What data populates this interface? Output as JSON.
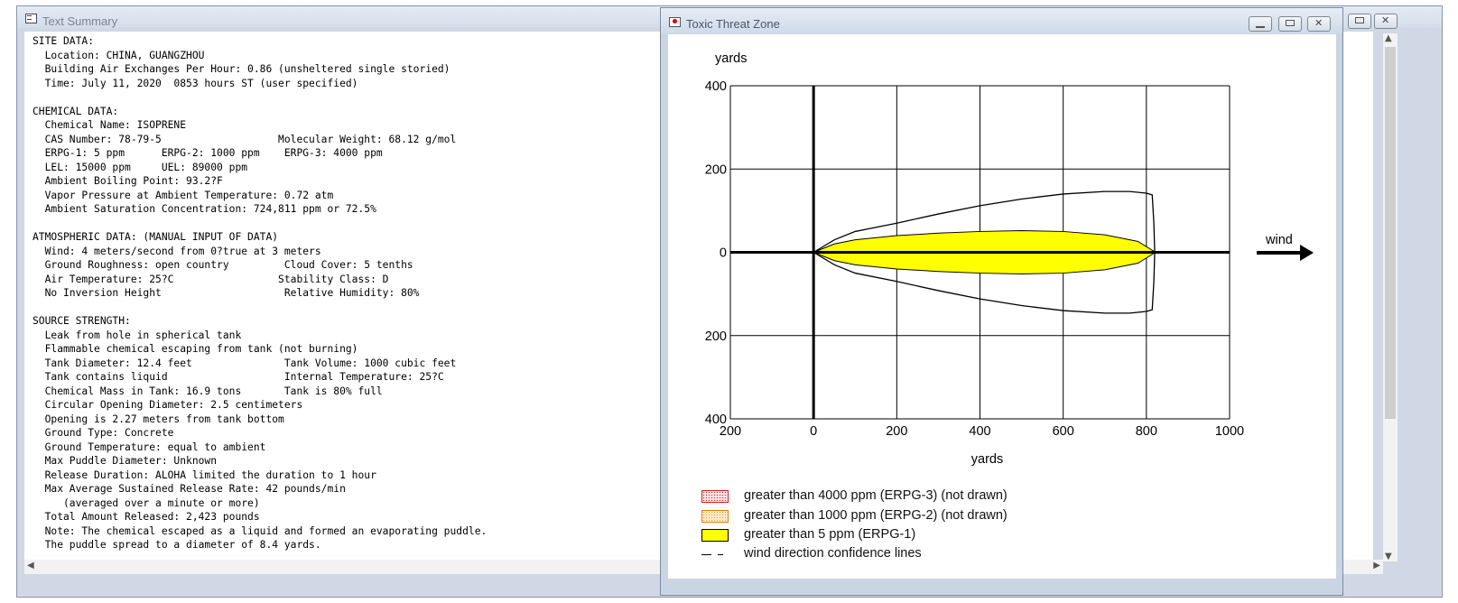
{
  "summary_window": {
    "title": "Text Summary",
    "lines": [
      "SITE DATA:",
      "  Location: CHINA, GUANGZHOU",
      "  Building Air Exchanges Per Hour: 0.86 (unsheltered single storied)",
      "  Time: July 11, 2020  0853 hours ST (user specified)",
      "",
      "CHEMICAL DATA:",
      "  Chemical Name: ISOPRENE",
      "  CAS Number: 78-79-5                   Molecular Weight: 68.12 g/mol",
      "  ERPG-1: 5 ppm      ERPG-2: 1000 ppm    ERPG-3: 4000 ppm",
      "  LEL: 15000 ppm     UEL: 89000 ppm",
      "  Ambient Boiling Point: 93.2?F",
      "  Vapor Pressure at Ambient Temperature: 0.72 atm",
      "  Ambient Saturation Concentration: 724,811 ppm or 72.5%",
      "",
      "ATMOSPHERIC DATA: (MANUAL INPUT OF DATA)",
      "  Wind: 4 meters/second from 0?true at 3 meters",
      "  Ground Roughness: open country         Cloud Cover: 5 tenths",
      "  Air Temperature: 25?C                 Stability Class: D",
      "  No Inversion Height                    Relative Humidity: 80%",
      "",
      "SOURCE STRENGTH:",
      "  Leak from hole in spherical tank",
      "  Flammable chemical escaping from tank (not burning)",
      "  Tank Diameter: 12.4 feet               Tank Volume: 1000 cubic feet",
      "  Tank contains liquid                   Internal Temperature: 25?C",
      "  Chemical Mass in Tank: 16.9 tons       Tank is 80% full",
      "  Circular Opening Diameter: 2.5 centimeters",
      "  Opening is 2.27 meters from tank bottom",
      "  Ground Type: Concrete",
      "  Ground Temperature: equal to ambient",
      "  Max Puddle Diameter: Unknown",
      "  Release Duration: ALOHA limited the duration to 1 hour",
      "  Max Average Sustained Release Rate: 42 pounds/min",
      "     (averaged over a minute or more)",
      "  Total Amount Released: 2,423 pounds",
      "  Note: The chemical escaped as a liquid and formed an evaporating puddle.",
      "  The puddle spread to a diameter of 8.4 yards."
    ]
  },
  "threat_window": {
    "title": "Toxic Threat Zone",
    "legend": [
      {
        "id": "erpg3",
        "label": "greater than 4000 ppm (ERPG-3) (not drawn)",
        "color": "#d02020"
      },
      {
        "id": "erpg2",
        "label": "greater than 1000 ppm (ERPG-2) (not drawn)",
        "color": "#e8a040"
      },
      {
        "id": "erpg1",
        "label": "greater than 5 ppm (ERPG-1)",
        "color": "#ffff00"
      },
      {
        "id": "conf",
        "label": "wind direction confidence lines",
        "color": "#000000"
      }
    ]
  },
  "chart_data": {
    "type": "area",
    "xlabel": "yards",
    "ylabel": "yards",
    "xlim": [
      -200,
      1000
    ],
    "ylim": [
      -400,
      400
    ],
    "x_tick_values": [
      -200,
      0,
      200,
      400,
      600,
      800,
      1000
    ],
    "x_tick_labels": [
      "200",
      "0",
      "200",
      "400",
      "600",
      "800",
      "1000"
    ],
    "y_tick_values": [
      400,
      200,
      0,
      -200,
      -400
    ],
    "y_tick_labels": [
      "400",
      "200",
      "0",
      "200",
      "400"
    ],
    "grid": true,
    "wind_label": "wind",
    "series": [
      {
        "name": "greater than 5 ppm (ERPG-1)",
        "kind": "zone",
        "color": "#ffff00",
        "x": [
          0,
          50,
          100,
          200,
          300,
          400,
          500,
          600,
          700,
          780,
          822
        ],
        "y": [
          0,
          20,
          30,
          40,
          46,
          50,
          52,
          50,
          42,
          26,
          0
        ]
      },
      {
        "name": "wind direction confidence lines",
        "kind": "confidence",
        "color": "#000000",
        "x": [
          0,
          50,
          100,
          200,
          300,
          400,
          500,
          600,
          700,
          760,
          800,
          814,
          818,
          820
        ],
        "y": [
          0,
          30,
          50,
          70,
          92,
          112,
          128,
          140,
          146,
          146,
          142,
          138,
          70,
          0
        ]
      }
    ]
  }
}
